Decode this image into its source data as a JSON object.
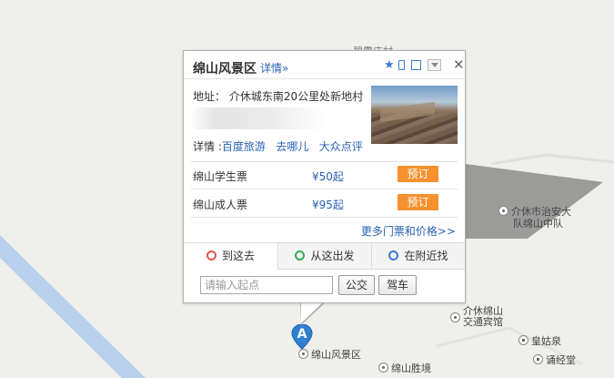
{
  "map": {
    "colors": {
      "land": "#efefeb",
      "river": "#b9d0ec",
      "shadow": "#8c8c8c"
    },
    "top_label": "碧露庄村",
    "pois": [
      {
        "name": "介休市治安大队绵山中队",
        "line1": "介休市治安大",
        "line2": "队绵山中队",
        "icon": "poi-icon"
      },
      {
        "name": "介休绵山交通宾馆",
        "line1": "介休绵山",
        "line2": "交通宾馆",
        "icon": "hotel-icon"
      },
      {
        "name": "皇姑泉",
        "icon": "house-icon"
      },
      {
        "name": "诵经堂",
        "icon": "house-icon"
      },
      {
        "name": "绵山风景区",
        "icon": "scenic-icon"
      },
      {
        "name": "绵山胜境",
        "icon": "scenic-icon"
      }
    ],
    "marker": {
      "label": "A",
      "color": "#2f80d1"
    }
  },
  "popup": {
    "title": "绵山风景区",
    "detail_link": "详情»",
    "icons": [
      "star-icon",
      "phone-icon",
      "edit-icon",
      "dropdown-icon",
      "close-icon"
    ],
    "close_glyph": "✕",
    "address": "地址：  介休城东南20公里处新地村",
    "details_label": "详情 :",
    "detail_links": [
      "百度旅游",
      "去哪儿",
      "大众点评"
    ],
    "tickets": [
      {
        "name": "绵山学生票",
        "price": "¥50起",
        "action": "预订"
      },
      {
        "name": "绵山成人票",
        "price": "¥95起",
        "action": "预订"
      }
    ],
    "more_tickets": "更多门票和价格>>",
    "tabs": [
      {
        "label": "到这去",
        "icon_color": "#e05a4f",
        "active": true
      },
      {
        "label": "从这出发",
        "icon_color": "#3aa858",
        "active": false
      },
      {
        "label": "在附近找",
        "icon_color": "#3b7ad8",
        "active": false
      }
    ],
    "start_placeholder": "请输入起点",
    "start_value": "",
    "buttons": {
      "bus": "公交",
      "drive": "驾车"
    }
  }
}
